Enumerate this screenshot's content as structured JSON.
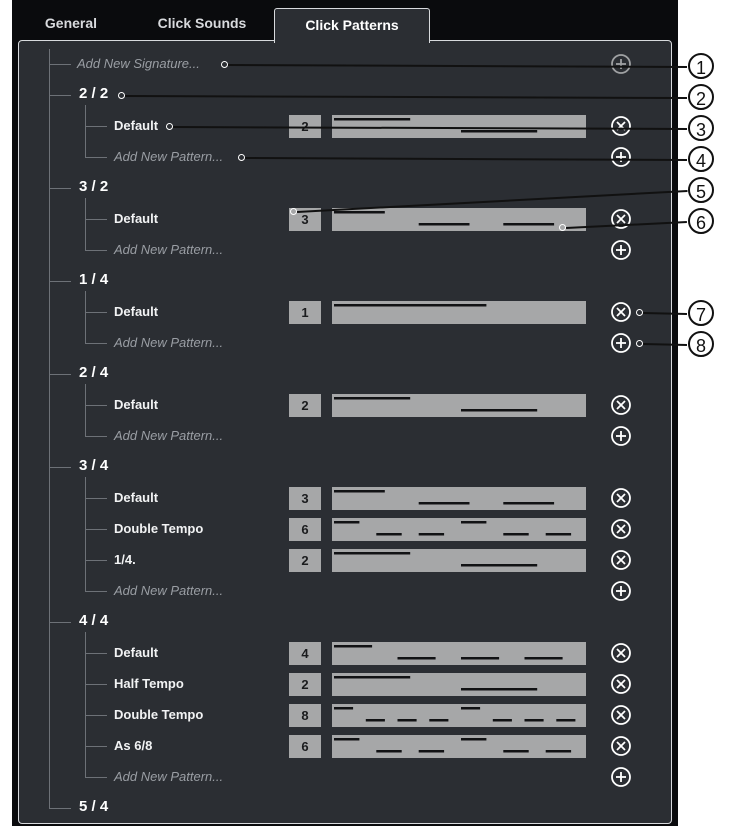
{
  "tabs": [
    {
      "label": "General",
      "active": false
    },
    {
      "label": "Click Sounds",
      "active": false
    },
    {
      "label": "Click Patterns",
      "active": true
    }
  ],
  "add_signature_label": "Add New Signature...",
  "add_pattern_label": "Add New Pattern...",
  "colors": {
    "panel": "#2b2e33",
    "bar": "#a6a7a8",
    "text": "#ffffff",
    "muted": "#9a9ea4"
  },
  "signatures": [
    {
      "label": "2 / 2",
      "patterns": [
        {
          "name": "Default",
          "count": "2",
          "beats": [
            1,
            0
          ]
        }
      ]
    },
    {
      "label": "3 / 2",
      "patterns": [
        {
          "name": "Default",
          "count": "3",
          "beats": [
            1,
            0,
            0
          ]
        }
      ]
    },
    {
      "label": "1 / 4",
      "patterns": [
        {
          "name": "Default",
          "count": "1",
          "beats": [
            1
          ]
        }
      ]
    },
    {
      "label": "2 / 4",
      "patterns": [
        {
          "name": "Default",
          "count": "2",
          "beats": [
            1,
            0
          ]
        }
      ]
    },
    {
      "label": "3 / 4",
      "patterns": [
        {
          "name": "Default",
          "count": "3",
          "beats": [
            1,
            0,
            0
          ]
        },
        {
          "name": "Double Tempo",
          "count": "6",
          "beats": [
            1,
            0,
            0,
            1,
            0,
            0
          ]
        },
        {
          "name": "1/4.",
          "count": "2",
          "beats": [
            1,
            0
          ]
        }
      ]
    },
    {
      "label": "4 / 4",
      "patterns": [
        {
          "name": "Default",
          "count": "4",
          "beats": [
            1,
            0,
            0,
            0
          ]
        },
        {
          "name": "Half Tempo",
          "count": "2",
          "beats": [
            1,
            0
          ]
        },
        {
          "name": "Double Tempo",
          "count": "8",
          "beats": [
            1,
            0,
            0,
            0,
            1,
            0,
            0,
            0
          ]
        },
        {
          "name": "As 6/8",
          "count": "6",
          "beats": [
            1,
            0,
            0,
            1,
            0,
            0
          ]
        }
      ]
    },
    {
      "label": "5 / 4",
      "patterns": []
    }
  ],
  "callouts": [
    "1",
    "2",
    "3",
    "4",
    "5",
    "6",
    "7",
    "8"
  ]
}
